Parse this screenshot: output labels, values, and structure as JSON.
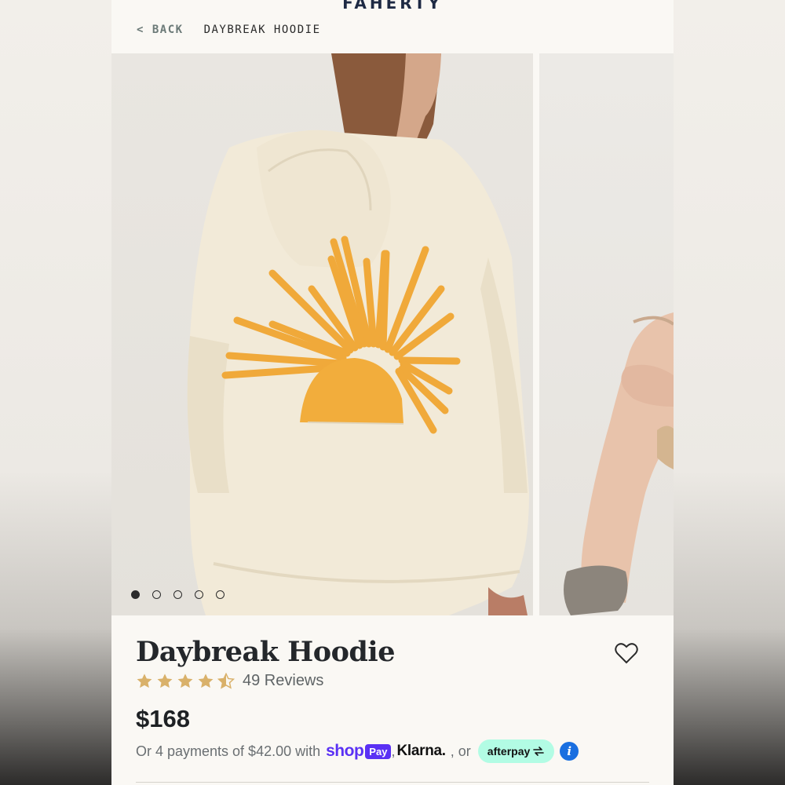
{
  "header": {
    "brand": "FAHERTY",
    "back_label": "< BACK",
    "breadcrumb_current": "DAYBREAK HOODIE"
  },
  "gallery": {
    "image_count": 5,
    "active_index": 0
  },
  "product": {
    "title": "Daybreak Hoodie",
    "rating": 4.5,
    "rating_max": 5,
    "reviews_label": "49 Reviews",
    "price": "$168"
  },
  "payment": {
    "installment_text": "Or 4 payments of $42.00 with",
    "shop_word": "shop",
    "shop_pay_badge": "Pay",
    "comma": ",",
    "klarna": "Klarna.",
    "or_text": ", or",
    "afterpay": "afterpay"
  },
  "colors": {
    "brand_navy": "#1e2a44",
    "star_gold": "#d9b16a",
    "shop_pay_purple": "#5a31f4",
    "afterpay_mint": "#b2fce4",
    "info_blue": "#1a6fe0"
  }
}
